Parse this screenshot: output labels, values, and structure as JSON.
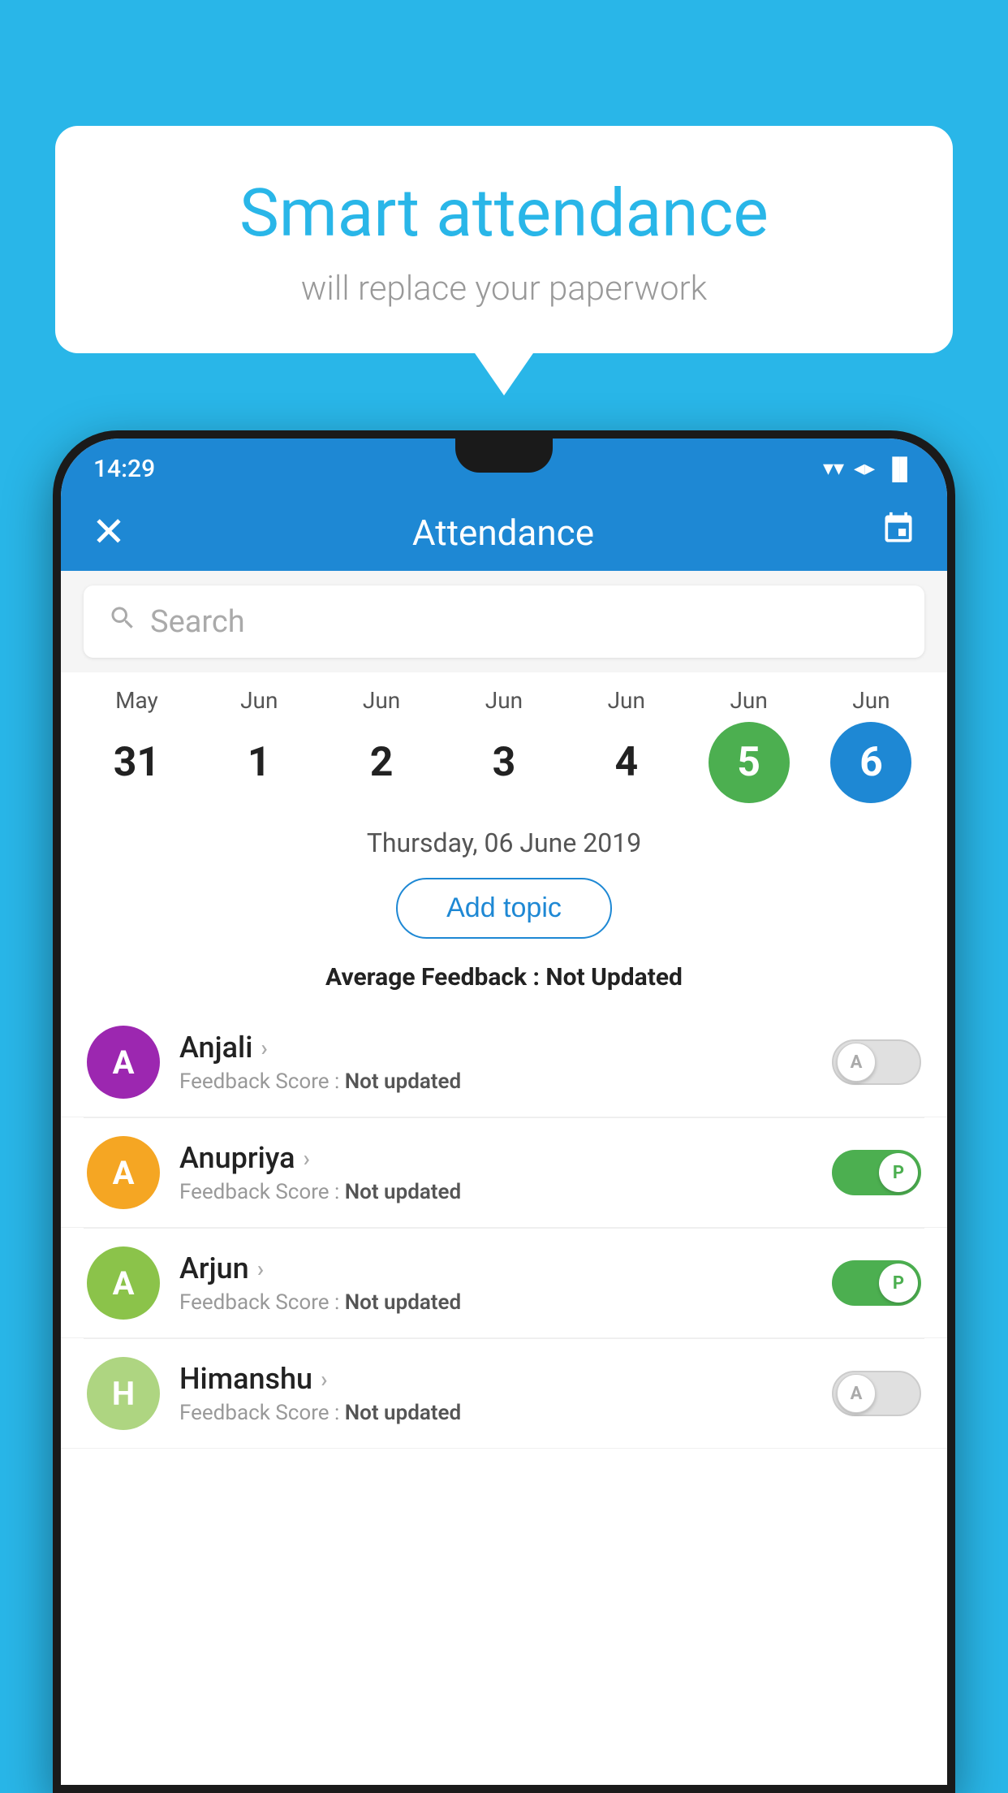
{
  "background_color": "#29b6e8",
  "speech_bubble": {
    "title": "Smart attendance",
    "subtitle": "will replace your paperwork"
  },
  "status_bar": {
    "time": "14:29",
    "wifi": "▼",
    "signal": "▲",
    "battery": "▐"
  },
  "app_bar": {
    "title": "Attendance",
    "close_icon": "×",
    "calendar_icon": "📅"
  },
  "search": {
    "placeholder": "Search"
  },
  "calendar": {
    "days": [
      {
        "month": "May",
        "date": "31",
        "state": "normal"
      },
      {
        "month": "Jun",
        "date": "1",
        "state": "normal"
      },
      {
        "month": "Jun",
        "date": "2",
        "state": "normal"
      },
      {
        "month": "Jun",
        "date": "3",
        "state": "normal"
      },
      {
        "month": "Jun",
        "date": "4",
        "state": "normal"
      },
      {
        "month": "Jun",
        "date": "5",
        "state": "today"
      },
      {
        "month": "Jun",
        "date": "6",
        "state": "selected"
      }
    ]
  },
  "selected_date": "Thursday, 06 June 2019",
  "add_topic_label": "Add topic",
  "average_feedback": {
    "label": "Average Feedback : ",
    "value": "Not Updated"
  },
  "students": [
    {
      "name": "Anjali",
      "avatar_letter": "A",
      "avatar_color": "#9c27b0",
      "feedback_label": "Feedback Score : ",
      "feedback_value": "Not updated",
      "toggle_state": "off",
      "toggle_label": "A"
    },
    {
      "name": "Anupriya",
      "avatar_letter": "A",
      "avatar_color": "#f5a623",
      "feedback_label": "Feedback Score : ",
      "feedback_value": "Not updated",
      "toggle_state": "on",
      "toggle_label": "P"
    },
    {
      "name": "Arjun",
      "avatar_letter": "A",
      "avatar_color": "#8bc34a",
      "feedback_label": "Feedback Score : ",
      "feedback_value": "Not updated",
      "toggle_state": "on",
      "toggle_label": "P"
    },
    {
      "name": "Himanshu",
      "avatar_letter": "H",
      "avatar_color": "#aed581",
      "feedback_label": "Feedback Score : ",
      "feedback_value": "Not updated",
      "toggle_state": "off",
      "toggle_label": "A"
    }
  ]
}
